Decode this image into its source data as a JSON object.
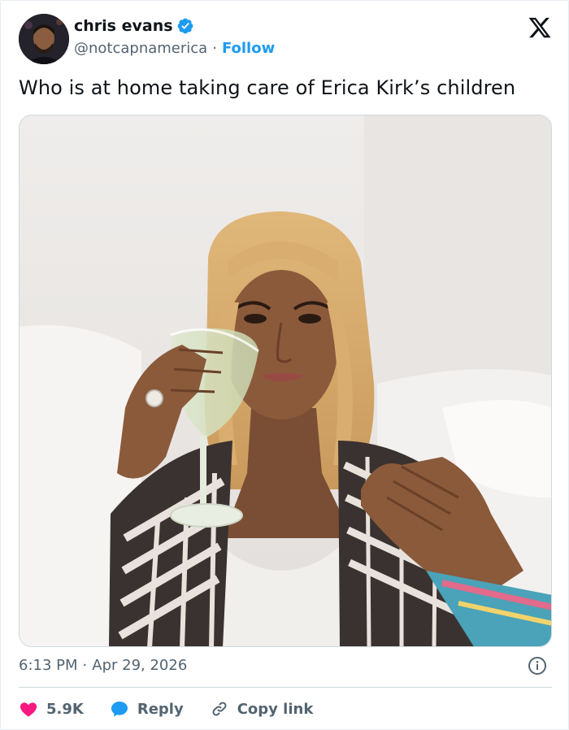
{
  "tweet": {
    "author_name": "chris evans",
    "author_handle": "@notcapnamerica",
    "separator": "·",
    "follow_label": "Follow",
    "text": "Who is at home taking care of Erica Kirk’s children",
    "time": "6:13 PM",
    "date": "Apr 29, 2026"
  },
  "actions": {
    "likes": "5.9K",
    "reply_label": "Reply",
    "copy_link_label": "Copy link"
  },
  "icons": {
    "verified": "verified-badge-icon",
    "brand": "x-logo-icon",
    "info": "info-icon",
    "like": "heart-icon",
    "reply": "speech-bubble-icon",
    "copy": "link-icon"
  },
  "colors": {
    "accent": "#1d9bf0",
    "like": "#f91880",
    "text": "#0f1419",
    "secondary": "#536471"
  }
}
